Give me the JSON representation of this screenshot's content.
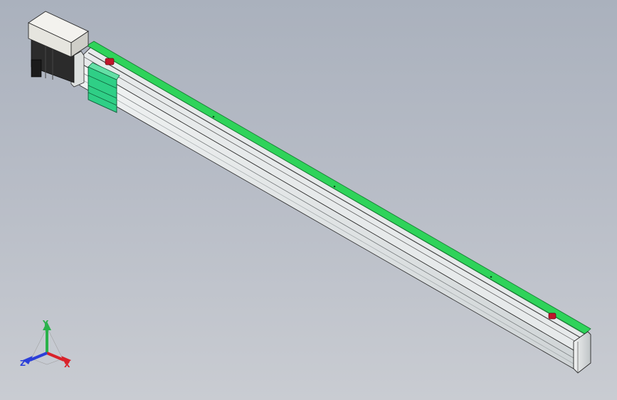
{
  "viewport": {
    "background_top": "#aab1bd",
    "background_bottom": "#c9ccd2"
  },
  "model": {
    "rail_color": "#e3e7ea",
    "rack_color": "#2fd35a",
    "carriage_color": "#2fcf86",
    "motor_housing_color": "#e6e5df",
    "motor_body_color": "#2b2b2b",
    "sensor_color": "#c0152a"
  },
  "triad": {
    "x_label": "X",
    "y_label": "Y",
    "z_label": "Z",
    "x_color": "#d9222a",
    "y_color": "#2ab24a",
    "z_color": "#2b3fd9"
  }
}
